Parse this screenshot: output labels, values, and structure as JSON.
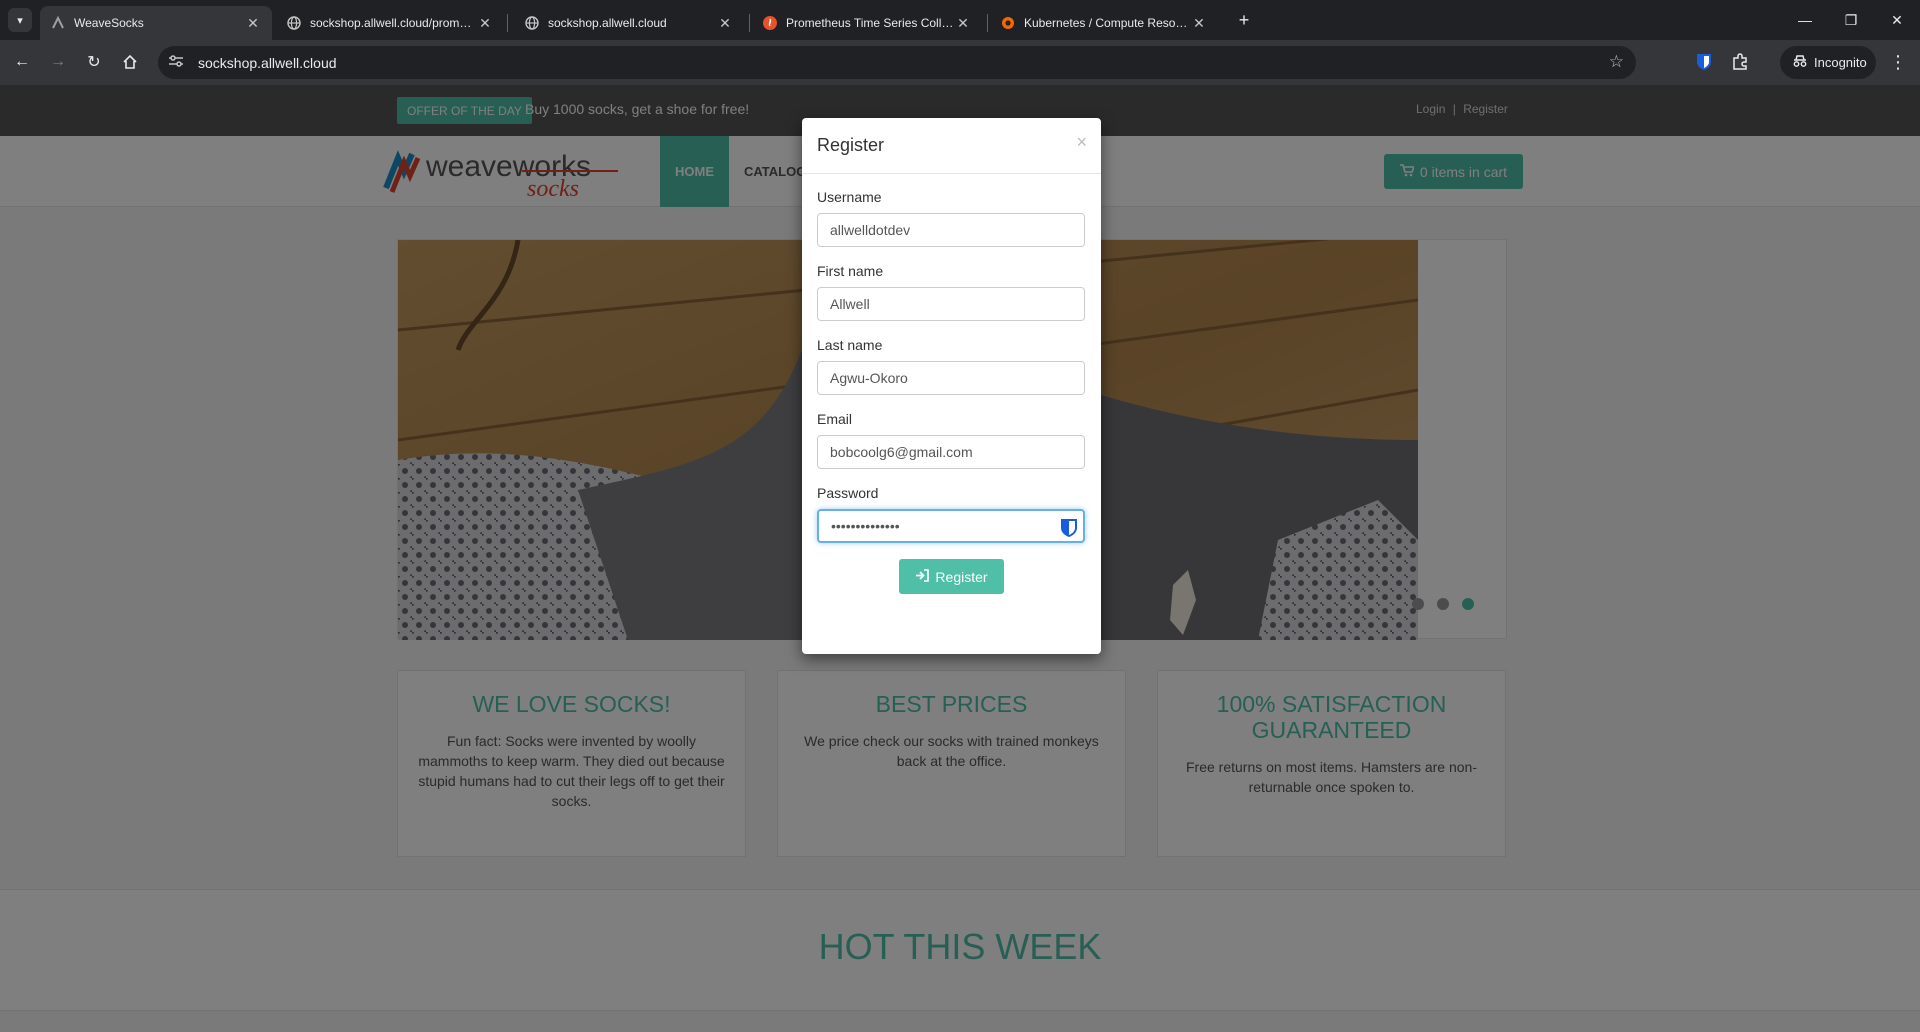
{
  "browser": {
    "tabs": [
      {
        "title": "WeaveSocks",
        "icon": "weavesocks-favicon-icon",
        "active": true
      },
      {
        "title": "sockshop.allwell.cloud/prometh",
        "icon": "globe-icon",
        "active": false
      },
      {
        "title": "sockshop.allwell.cloud",
        "icon": "globe-icon",
        "active": false
      },
      {
        "title": "Prometheus Time Series Collect",
        "icon": "prometheus-icon",
        "active": false
      },
      {
        "title": "Kubernetes / Compute Resourc",
        "icon": "grafana-icon",
        "active": false
      }
    ],
    "url": "sockshop.allwell.cloud",
    "incognito_label": "Incognito"
  },
  "site": {
    "offer_badge": "OFFER OF THE DAY",
    "offer_text": "Buy 1000 socks, get a shoe for free!",
    "login": "Login",
    "separator": "|",
    "register": "Register",
    "nav_home": "HOME",
    "nav_catalogue": "CATALOGUE",
    "cart": "0 items in cart",
    "boxes": [
      {
        "title": "WE LOVE SOCKS!",
        "text": "Fun fact: Socks were invented by woolly mammoths to keep warm. They died out because stupid humans had to cut their legs off to get their socks."
      },
      {
        "title": "BEST PRICES",
        "text": "We price check our socks with trained monkeys back at the office."
      },
      {
        "title": "100% SATISFACTION GUARANTEED",
        "text": "Free returns on most items. Hamsters are non-returnable once spoken to."
      }
    ],
    "hot_title": "HOT THIS WEEK",
    "carousel_active_slide": 3,
    "carousel_slide_count": 3
  },
  "modal": {
    "title": "Register",
    "close": "×",
    "username_label": "Username",
    "username_value": "allwelldotdev",
    "firstname_label": "First name",
    "firstname_value": "Allwell",
    "lastname_label": "Last name",
    "lastname_value": "Agwu-Okoro",
    "email_label": "Email",
    "email_value": "bobcoolg6@gmail.com",
    "password_label": "Password",
    "password_value": "••••••••••••••",
    "submit_label": "Register"
  },
  "colors": {
    "accent": "#4fbfa8",
    "topbar": "#555555"
  }
}
